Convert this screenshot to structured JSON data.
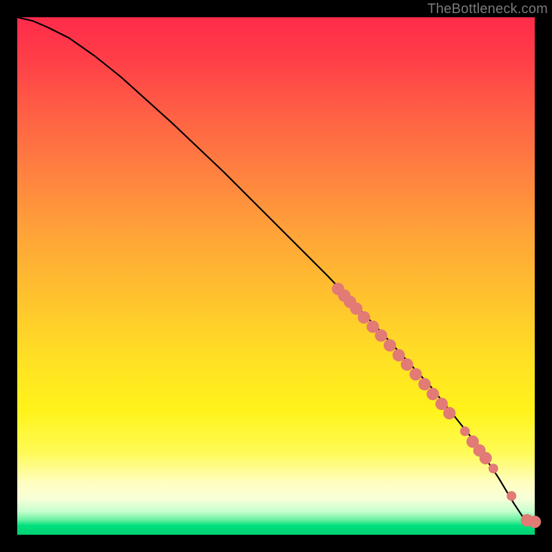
{
  "watermark": "TheBottleneck.com",
  "chart_data": {
    "type": "line",
    "title": "",
    "xlabel": "",
    "ylabel": "",
    "xlim": [
      0,
      100
    ],
    "ylim": [
      0,
      100
    ],
    "curve": {
      "x": [
        0,
        3,
        6,
        10,
        15,
        20,
        30,
        40,
        50,
        60,
        70,
        80,
        88,
        93,
        96,
        98,
        100
      ],
      "y": [
        100,
        99.3,
        98.0,
        96.0,
        92.5,
        88.5,
        79.5,
        70.0,
        60.0,
        50.0,
        39.5,
        28.5,
        18.5,
        11.0,
        6.0,
        3.0,
        2.5
      ]
    },
    "series": [
      {
        "name": "cluster-points",
        "marker": "circle",
        "radius_large": 9,
        "radius_small": 7,
        "points": [
          {
            "x": 62.0,
            "y": 47.5,
            "r": "large"
          },
          {
            "x": 63.2,
            "y": 46.2,
            "r": "large"
          },
          {
            "x": 64.3,
            "y": 45.0,
            "r": "large"
          },
          {
            "x": 65.5,
            "y": 43.7,
            "r": "large"
          },
          {
            "x": 67.0,
            "y": 42.0,
            "r": "large"
          },
          {
            "x": 68.7,
            "y": 40.2,
            "r": "large"
          },
          {
            "x": 70.3,
            "y": 38.5,
            "r": "large"
          },
          {
            "x": 72.0,
            "y": 36.6,
            "r": "large"
          },
          {
            "x": 73.7,
            "y": 34.7,
            "r": "large"
          },
          {
            "x": 75.3,
            "y": 32.9,
            "r": "large"
          },
          {
            "x": 77.0,
            "y": 31.0,
            "r": "large"
          },
          {
            "x": 78.7,
            "y": 29.1,
            "r": "large"
          },
          {
            "x": 80.3,
            "y": 27.2,
            "r": "large"
          },
          {
            "x": 82.0,
            "y": 25.3,
            "r": "large"
          },
          {
            "x": 83.5,
            "y": 23.5,
            "r": "large"
          },
          {
            "x": 86.5,
            "y": 20.0,
            "r": "small"
          },
          {
            "x": 88.0,
            "y": 18.0,
            "r": "large"
          },
          {
            "x": 89.3,
            "y": 16.3,
            "r": "large"
          },
          {
            "x": 90.5,
            "y": 14.8,
            "r": "large"
          },
          {
            "x": 92.0,
            "y": 12.8,
            "r": "small"
          },
          {
            "x": 95.5,
            "y": 7.5,
            "r": "small"
          },
          {
            "x": 98.5,
            "y": 2.8,
            "r": "large"
          },
          {
            "x": 100.0,
            "y": 2.5,
            "r": "large"
          }
        ]
      }
    ],
    "background": {
      "type": "vertical-gradient",
      "stops": [
        {
          "pos": 0.0,
          "color": "#ff2b4a"
        },
        {
          "pos": 0.5,
          "color": "#ffc22e"
        },
        {
          "pos": 0.8,
          "color": "#fffb55"
        },
        {
          "pos": 0.95,
          "color": "#c6ffce"
        },
        {
          "pos": 1.0,
          "color": "#00d072"
        }
      ]
    }
  }
}
